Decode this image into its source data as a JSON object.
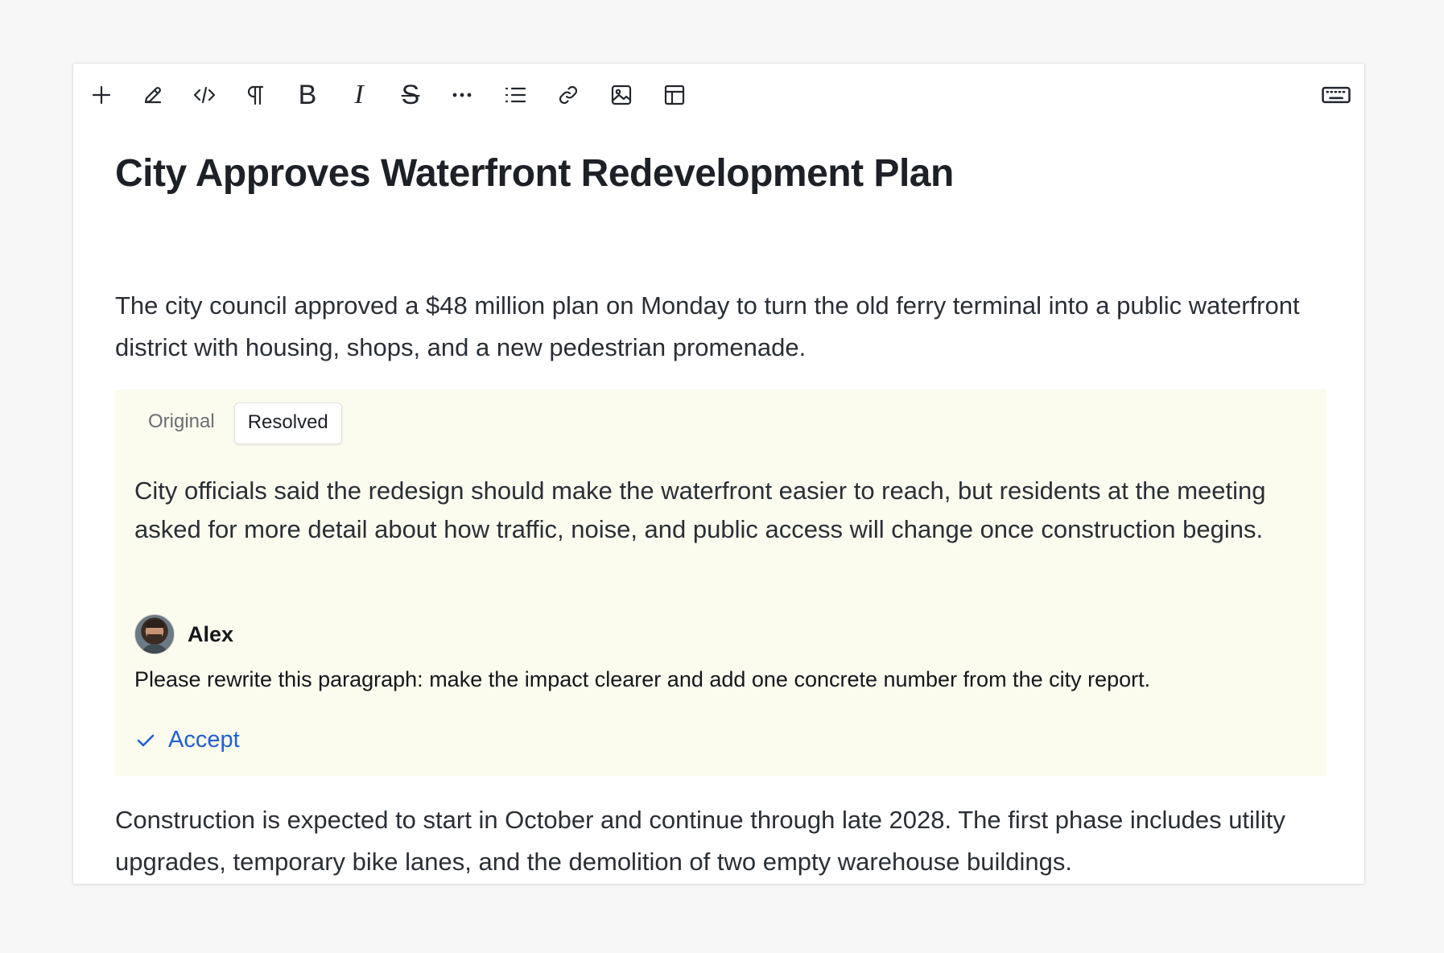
{
  "toolbar": {
    "tools": [
      {
        "name": "add-button",
        "icon": "plus-icon"
      },
      {
        "name": "edit-button",
        "icon": "pencil-icon"
      },
      {
        "name": "code-button",
        "icon": "code-icon"
      },
      {
        "name": "paragraph-button",
        "icon": "pilcrow-icon"
      },
      {
        "name": "bold-button",
        "icon": "bold-icon",
        "glyph": "B"
      },
      {
        "name": "italic-button",
        "icon": "italic-icon",
        "glyph": "I"
      },
      {
        "name": "strikethrough-button",
        "icon": "strikethrough-icon",
        "glyph": "S"
      },
      {
        "name": "more-button",
        "icon": "ellipsis-icon"
      },
      {
        "name": "list-button",
        "icon": "bulleted-list-icon"
      },
      {
        "name": "link-button",
        "icon": "link-icon"
      },
      {
        "name": "image-button",
        "icon": "image-icon"
      },
      {
        "name": "table-button",
        "icon": "table-icon"
      }
    ],
    "keyboard_icon": "keyboard-icon"
  },
  "document": {
    "title": "City Approves Waterfront Redevelopment Plan",
    "intro": "The city council approved a $48 million plan on Monday to turn the old ferry terminal into a public waterfront district with housing, shops, and a new pedestrian promenade.",
    "outro": "Construction is expected to start in October and continue through late 2028. The first phase includes utility upgrades, temporary bike lanes, and the demolition of two empty warehouse buildings."
  },
  "suggestion": {
    "tabs": [
      {
        "label": "Original",
        "active": false
      },
      {
        "label": "Resolved",
        "active": true
      }
    ],
    "resolved_text": "City officials said the redesign should make the waterfront easier to reach, but residents at the meeting asked for more detail about how traffic, noise, and public access will change once construction begins.",
    "comment": {
      "author": "Alex",
      "text": "Please rewrite this paragraph: make the impact clearer and add one concrete number from the city report."
    },
    "accept_label": "Accept",
    "background_color": "#fbfbee",
    "accent_color": "#1f5fd4"
  }
}
